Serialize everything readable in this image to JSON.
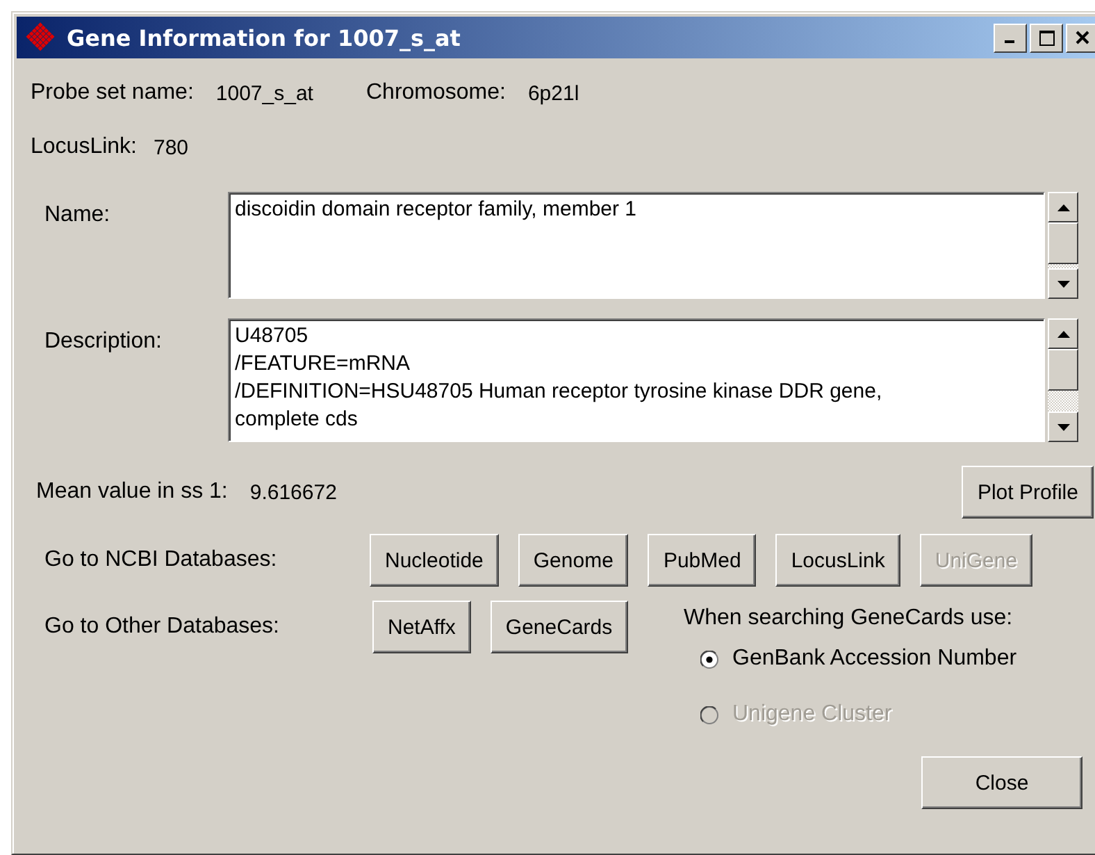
{
  "window": {
    "title": "Gene Information for 1007_s_at"
  },
  "probe_set_name": {
    "label": "Probe set name:",
    "value": "1007_s_at"
  },
  "chromosome": {
    "label": "Chromosome:",
    "value": "6p21l"
  },
  "locuslink": {
    "label": "LocusLink:",
    "value": "780"
  },
  "name_field": {
    "label": "Name:",
    "value": "discoidin domain receptor family, member 1"
  },
  "description_field": {
    "label": "Description:",
    "value": "U48705\n/FEATURE=mRNA\n/DEFINITION=HSU48705 Human receptor tyrosine kinase DDR gene,\ncomplete cds"
  },
  "mean_value": {
    "label": "Mean value in ss 1:",
    "value": "9.616672"
  },
  "plot_button": {
    "label": "Plot Profile"
  },
  "ncbi": {
    "label": "Go to NCBI Databases:",
    "buttons": [
      {
        "label": "Nucleotide",
        "disabled": false
      },
      {
        "label": "Genome",
        "disabled": false
      },
      {
        "label": "PubMed",
        "disabled": false
      },
      {
        "label": "LocusLink",
        "disabled": false
      },
      {
        "label": "UniGene",
        "disabled": true
      }
    ]
  },
  "other": {
    "label": "Go to Other Databases:",
    "buttons": [
      {
        "label": "NetAffx",
        "disabled": false
      },
      {
        "label": "GeneCards",
        "disabled": false
      }
    ]
  },
  "genecards_option": {
    "label": "When searching GeneCards use:",
    "options": [
      {
        "label": "GenBank Accession Number",
        "selected": true,
        "disabled": false
      },
      {
        "label": "Unigene Cluster",
        "selected": false,
        "disabled": true
      }
    ]
  },
  "close_button": {
    "label": "Close"
  }
}
